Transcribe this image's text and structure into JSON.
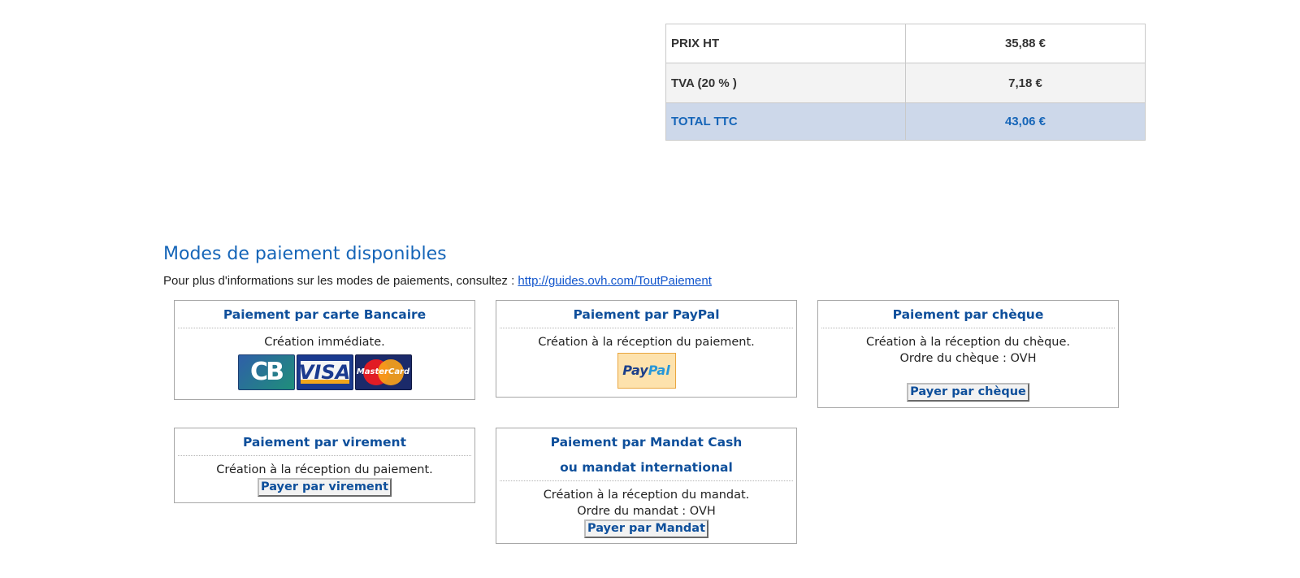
{
  "totals": {
    "rows": [
      {
        "label": "PRIX HT",
        "value": "35,88 €"
      },
      {
        "label": "TVA (20 % )",
        "value": "7,18 €"
      },
      {
        "label": "TOTAL TTC",
        "value": "43,06 €"
      }
    ]
  },
  "payment_section": {
    "title": "Modes de paiement disponibles",
    "info_text": "Pour plus d'informations sur les modes de paiements, consultez : ",
    "info_link": "http://guides.ovh.com/ToutPaiement"
  },
  "methods": {
    "card": {
      "title": "Paiement par carte Bancaire",
      "desc": "Création immédiate.",
      "logos": [
        "CB",
        "VISA",
        "MasterCard"
      ]
    },
    "paypal": {
      "title": "Paiement par PayPal",
      "desc": "Création à la réception du paiement.",
      "logo_part1": "Pay",
      "logo_part2": "Pal"
    },
    "cheque": {
      "title": "Paiement par chèque",
      "desc": "Création à la réception du chèque.",
      "order": "Ordre du chèque : OVH",
      "button": "Payer par chèque"
    },
    "virement": {
      "title": "Paiement par virement",
      "desc": "Création à la réception du paiement.",
      "button": "Payer par virement"
    },
    "mandat": {
      "title_line1": "Paiement par Mandat Cash",
      "title_line2": "ou mandat international",
      "desc": "Création à la réception du mandat.",
      "order": "Ordre du mandat : OVH",
      "button": "Payer par Mandat"
    }
  },
  "colors": {
    "accent": "#1565b8",
    "title_blue": "#0e4f9b",
    "total_row_bg": "#cdd8ea"
  }
}
